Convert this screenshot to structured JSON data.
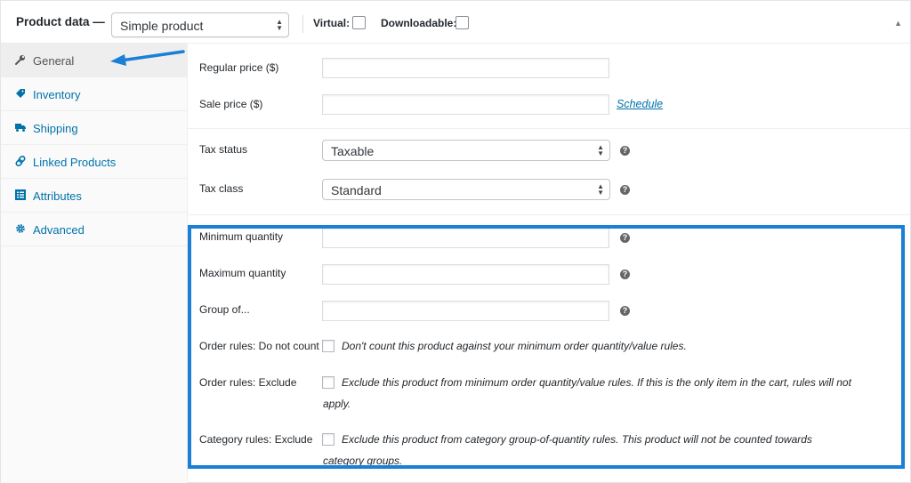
{
  "header": {
    "title": "Product data —",
    "product_type": "Simple product",
    "virtual_label": "Virtual:",
    "downloadable_label": "Downloadable:"
  },
  "sidebar": {
    "items": [
      {
        "label": "General",
        "icon": "wrench-icon"
      },
      {
        "label": "Inventory",
        "icon": "tag-icon"
      },
      {
        "label": "Shipping",
        "icon": "truck-icon"
      },
      {
        "label": "Linked Products",
        "icon": "link-icon"
      },
      {
        "label": "Attributes",
        "icon": "list-icon"
      },
      {
        "label": "Advanced",
        "icon": "gear-icon"
      }
    ],
    "active": "General"
  },
  "general": {
    "regular_price_label": "Regular price ($)",
    "regular_price_value": "",
    "sale_price_label": "Sale price ($)",
    "sale_price_value": "",
    "schedule_link": "Schedule",
    "tax_status_label": "Tax status",
    "tax_status_value": "Taxable",
    "tax_class_label": "Tax class",
    "tax_class_value": "Standard"
  },
  "quantity_rules": {
    "min_label": "Minimum quantity",
    "max_label": "Maximum quantity",
    "group_label": "Group of...",
    "order_no_count_label": "Order rules: Do not count",
    "order_no_count_desc": "Don't count this product against your minimum order quantity/value rules.",
    "order_exclude_label": "Order rules: Exclude",
    "order_exclude_desc_1": "Exclude this product from minimum order quantity/value rules. If this is the only item in the cart, rules will not",
    "order_exclude_desc_2": "apply.",
    "category_exclude_label": "Category rules: Exclude",
    "category_exclude_desc_1": "Exclude this product from category group-of-quantity rules. This product will not be counted towards",
    "category_exclude_desc_2": "category groups."
  },
  "help_glyph": "?",
  "colors": {
    "link": "#0073aa",
    "highlight": "#1a7fd6"
  }
}
